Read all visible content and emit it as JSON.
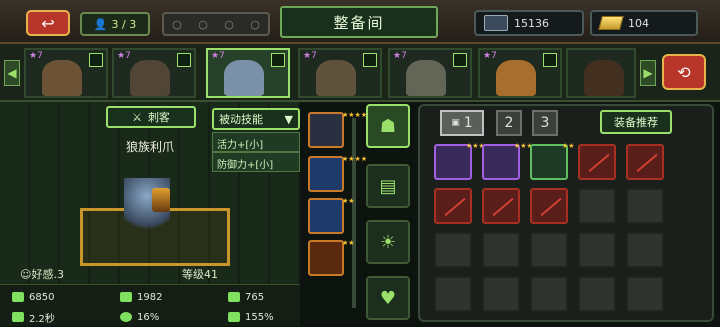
{
  "topbar": {
    "back_icon": "back-arrow-icon",
    "squad_count": "3 / 3",
    "title": "整备间",
    "cards": "15136",
    "gold": "104"
  },
  "heroes": [
    {
      "stars": "★7",
      "color": "#7a5a3a"
    },
    {
      "stars": "★7",
      "color": "#5a4a3a"
    },
    {
      "stars": "★7",
      "color": "#8aa0c0",
      "selected": true
    },
    {
      "stars": "★7",
      "color": "#6a5a40"
    },
    {
      "stars": "★7",
      "color": "#707060"
    },
    {
      "stars": "★7",
      "color": "#c07a30"
    },
    {
      "stars": "★7",
      "color": "#4a3020"
    }
  ],
  "hero": {
    "class_label": "刺客",
    "name": "狼族利爪",
    "favor": "好感.3",
    "level": "等级41"
  },
  "skills": {
    "dropdown_label": "被动技能",
    "items": [
      "活力+[小]",
      "防御力+[小]"
    ]
  },
  "stats": {
    "hp": "6850",
    "attack": "1982",
    "defense": "765",
    "speed": "2.2秒",
    "crit": "16%",
    "crit_dmg": "155%"
  },
  "inventory": {
    "tabs": [
      "1",
      "2",
      "3"
    ],
    "recommend_label": "装备推荐"
  }
}
